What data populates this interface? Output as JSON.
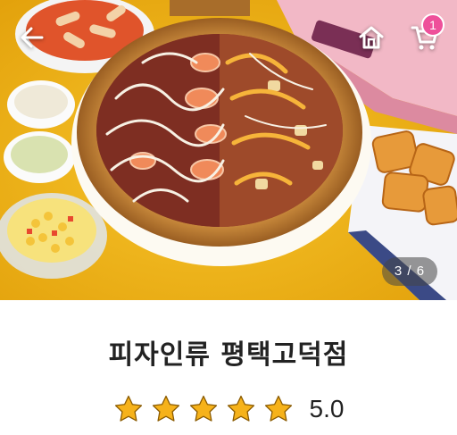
{
  "header": {
    "back_icon": "arrow-left-icon",
    "home_icon": "home-icon",
    "cart_icon": "cart-icon",
    "cart_count": "1"
  },
  "gallery": {
    "page_indicator": "3 / 6",
    "current": 3,
    "total": 6,
    "photo_subject": "pizza with shrimp, sauces, corn salad and waffle fries"
  },
  "store": {
    "name": "피자인류 평택고덕점",
    "rating_value": "5.0",
    "rating": 5,
    "rating_max": 5
  },
  "colors": {
    "badge": "#ee4f9a",
    "star": "#f6b21a",
    "background_yellow": "#f0b10f",
    "text": "#222222"
  }
}
